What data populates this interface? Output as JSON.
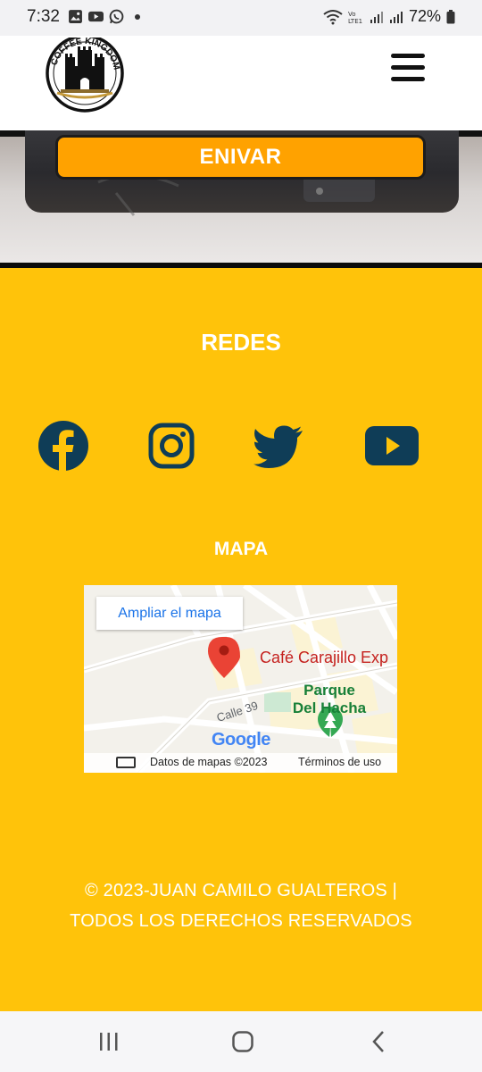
{
  "status_bar": {
    "time": "7:32",
    "battery": "72%",
    "icons_left": [
      "image-icon",
      "youtube-icon",
      "whatsapp-icon"
    ],
    "icons_right": [
      "wifi-icon",
      "volte-icon",
      "signal-icon",
      "signal-icon",
      "battery-icon"
    ]
  },
  "header": {
    "logo_text": "COFFEE KINGDOM",
    "menu_icon": "hamburger-menu-icon"
  },
  "form": {
    "submit_label": "ENIVAR"
  },
  "footer": {
    "social_title": "REDES",
    "social_links": [
      {
        "icon": "facebook-icon"
      },
      {
        "icon": "instagram-icon"
      },
      {
        "icon": "twitter-icon"
      },
      {
        "icon": "youtube-icon"
      }
    ],
    "map_title": "MAPA",
    "map": {
      "expand_label": "Ampliar el mapa",
      "place_label": "Café Carajillo Exp",
      "park_label_1": "Parque",
      "park_label_2": "Del Hacha",
      "street_label": "Calle 39",
      "brand": "Google",
      "data_label": "Datos de mapas ©2023",
      "terms_label": "Términos de uso"
    },
    "copyright_line1": "© 2023-JUAN CAMILO GUALTEROS |",
    "copyright_line2": "TODOS LOS DERECHOS RESERVADOS"
  },
  "colors": {
    "footer_bg": "#ffc30a",
    "button_bg": "#ffa200",
    "social_icon": "#0f3d57",
    "map_pin": "#ea4335"
  },
  "navbar": {
    "buttons": [
      "recent-apps-icon",
      "home-icon",
      "back-icon"
    ]
  }
}
